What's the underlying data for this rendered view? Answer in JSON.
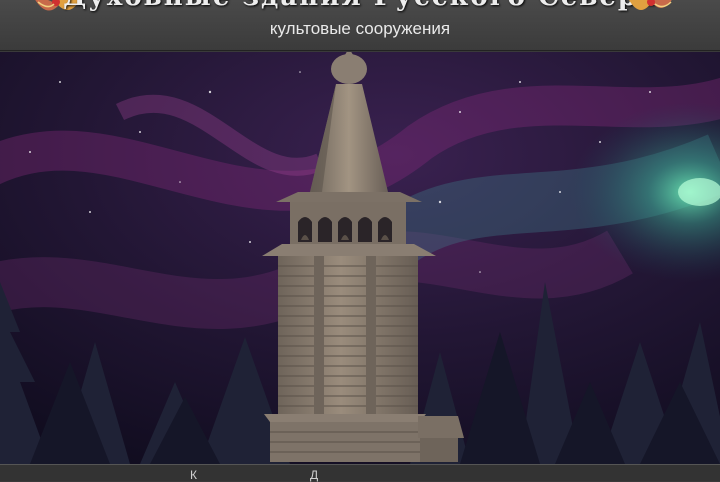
{
  "header": {
    "title": "Духовные здания Русского Севера",
    "subtitle": "культовые сооружения",
    "ornament_icon": "decorative-flower-ornament-icon"
  },
  "scene": {
    "image": "wooden-bell-tower-at-night-illustration",
    "sky_color": "#120f24",
    "aurora_colors": [
      "#7a2a7a",
      "#3a8a8a",
      "#58e0a0"
    ],
    "tower_color": "#8a7e72"
  },
  "nav": {
    "links": [
      "К",
      "Д"
    ]
  }
}
